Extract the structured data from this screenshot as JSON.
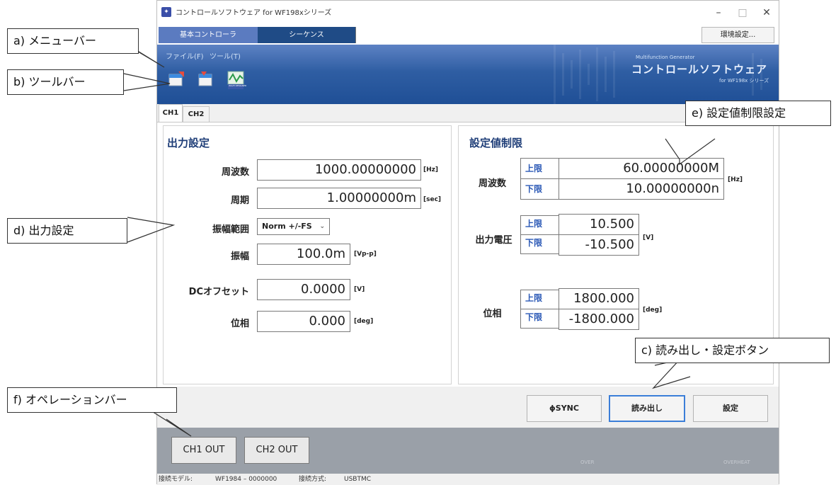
{
  "window": {
    "title": "コントロールソフトウェア for WF198xシリーズ",
    "controls": [
      "–",
      "□",
      "✕"
    ]
  },
  "main_tabs": {
    "basic": "基本コントローラ",
    "sequence": "シーケンス",
    "env_button": "環境設定..."
  },
  "menu": {
    "file": "ファイル(F)",
    "tools": "ツール(T)"
  },
  "brand": {
    "sub": "Multifunction Generator",
    "main": "コントロールソフトウェア",
    "model": "for WF198x シリーズ"
  },
  "toolbar": {
    "icons": [
      "open-file-icon",
      "save-file-icon",
      "wave-designer-icon"
    ],
    "wave_designer_text": "WAVE DESIGNER"
  },
  "channel_tabs": [
    "CH1",
    "CH2"
  ],
  "output": {
    "title": "出力設定",
    "frequency": {
      "label": "周波数",
      "value": "1000.00000000",
      "unit": "[Hz]"
    },
    "period": {
      "label": "周期",
      "value": "1.00000000m",
      "unit": "[sec]"
    },
    "amp_range": {
      "label": "振幅範囲",
      "value": "Norm +/-FS"
    },
    "amplitude": {
      "label": "振幅",
      "value": "100.0m",
      "unit": "[Vp-p]"
    },
    "dc_offset": {
      "label": "DCオフセット",
      "value": "0.0000",
      "unit": "[V]"
    },
    "phase": {
      "label": "位相",
      "value": "0.000",
      "unit": "[deg]"
    }
  },
  "limits": {
    "title": "設定値制限",
    "upper": "上限",
    "lower": "下限",
    "frequency": {
      "label": "周波数",
      "upper": "60.00000000M",
      "lower": "10.00000000n",
      "unit": "[Hz]"
    },
    "voltage": {
      "label": "出力電圧",
      "upper": "10.500",
      "lower": "-10.500",
      "unit": "[V]"
    },
    "phase": {
      "label": "位相",
      "upper": "1800.000",
      "lower": "-1800.000",
      "unit": "[deg]"
    }
  },
  "operation": {
    "sync": "ϕSYNC",
    "read": "読み出し",
    "set": "設定"
  },
  "status": {
    "ch1_out": "CH1 OUT",
    "ch2_out": "CH2 OUT",
    "over": "OVER",
    "overheat": "OVERHEAT"
  },
  "info": {
    "model_label": "接続モデル:",
    "model_value": "WF1984 – 0000000",
    "method_label": "接続方式:",
    "method_value": "USBTMC"
  },
  "callouts": {
    "a": "a) メニューバー",
    "b": "b) ツールバー",
    "c": "c) 読み出し・設定ボタン",
    "d": "d) 出力設定",
    "e": "e) 設定値制限設定",
    "f": "f) オペレーションバー"
  },
  "colors": {
    "banner": "#2f5ea3",
    "tab_active": "#5b7bc0",
    "tab_dark": "#1f4b86",
    "limit_tag": "#2b59b6",
    "group_title": "#1f3e78",
    "status_bar": "#9aa0a8"
  }
}
